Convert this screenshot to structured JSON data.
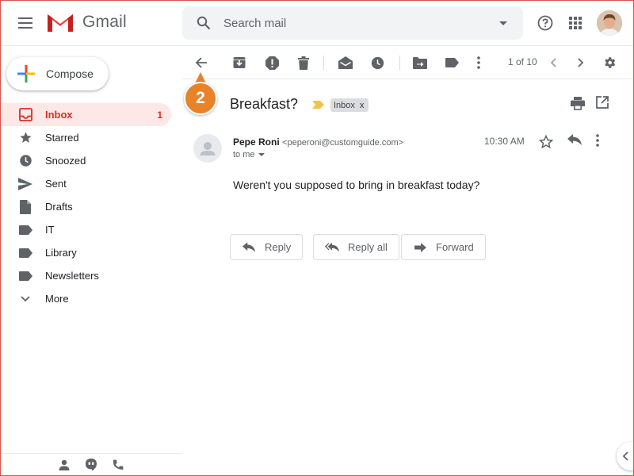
{
  "header": {
    "app_name": "Gmail",
    "search_placeholder": "Search mail"
  },
  "sidebar": {
    "compose_label": "Compose",
    "items": [
      {
        "label": "Inbox",
        "count": "1",
        "icon": "inbox-icon"
      },
      {
        "label": "Starred",
        "count": "",
        "icon": "star-icon"
      },
      {
        "label": "Snoozed",
        "count": "",
        "icon": "clock-icon"
      },
      {
        "label": "Sent",
        "count": "",
        "icon": "send-icon"
      },
      {
        "label": "Drafts",
        "count": "",
        "icon": "draft-icon"
      },
      {
        "label": "IT",
        "count": "",
        "icon": "label-icon"
      },
      {
        "label": "Library",
        "count": "",
        "icon": "label-icon"
      },
      {
        "label": "Newsletters",
        "count": "",
        "icon": "label-icon"
      },
      {
        "label": "More",
        "count": "",
        "icon": "chevron-down-icon"
      }
    ]
  },
  "toolbar": {
    "pager_text": "1 of 10"
  },
  "callout": {
    "step_number": "2"
  },
  "message": {
    "subject": "Breakfast?",
    "label_chip": "Inbox",
    "label_remove": "x",
    "sender_name": "Pepe Roni",
    "sender_email": "<peperoni@customguide.com>",
    "to_text": "to me",
    "time": "10:30 AM",
    "body": "Weren't you supposed to bring in breakfast today?"
  },
  "actions": {
    "reply": "Reply",
    "reply_all": "Reply all",
    "forward": "Forward"
  },
  "colors": {
    "accent_red": "#d93025",
    "inbox_active_bg": "#fce8e6",
    "callout_orange": "#e8832a",
    "importance_yellow": "#f2c24f"
  }
}
